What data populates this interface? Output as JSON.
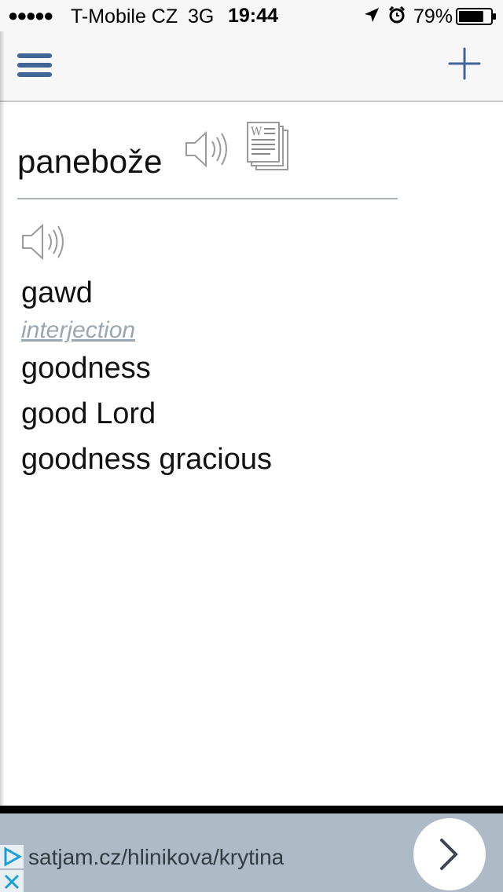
{
  "status_bar": {
    "signal": "●●●●●",
    "carrier": "T-Mobile CZ",
    "network": "3G",
    "time": "19:44",
    "battery_percent": "79%",
    "battery_level": 0.79
  },
  "nav": {
    "menu_icon": "hamburger-menu-icon",
    "add_icon": "plus-icon",
    "accent_color": "#3f6697"
  },
  "entry": {
    "headword": "panebože",
    "translations_top": [
      "gawd"
    ],
    "part_of_speech": "interjection",
    "translations": [
      "goodness",
      "good Lord",
      "goodness gracious"
    ]
  },
  "ad": {
    "url": "satjam.cz/hlinikova/krytina"
  }
}
